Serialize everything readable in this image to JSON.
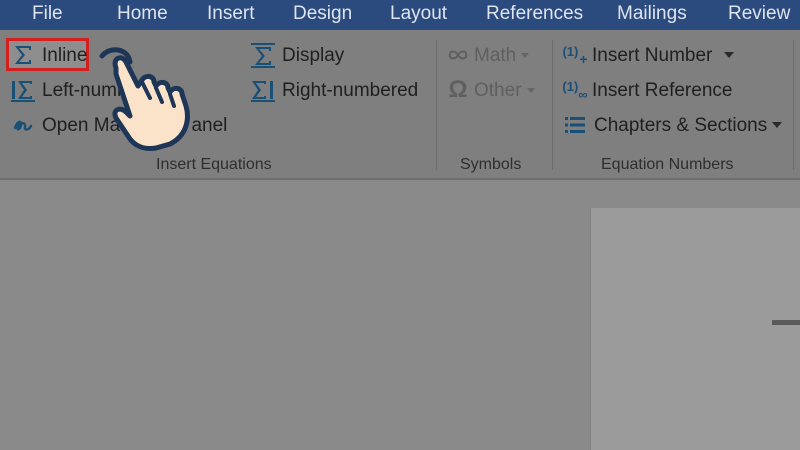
{
  "tabs": [
    "File",
    "Home",
    "Insert",
    "Design",
    "Layout",
    "References",
    "Mailings",
    "Review"
  ],
  "insert_equations": {
    "inline_label": "Inline",
    "display_label": "Display",
    "left_numbered_label": "Left-numb",
    "right_numbered_label": "Right-numbered",
    "math_panel_label_start": "Open Mat",
    "math_panel_label_end": "anel",
    "group_label": "Insert Equations"
  },
  "symbols": {
    "math_label": "Math",
    "other_label": "Other",
    "group_label": "Symbols"
  },
  "equation_numbers": {
    "insert_number_label": "Insert Number",
    "insert_reference_label": "Insert Reference",
    "chapters_label": "Chapters & Sections",
    "group_label": "Equation Numbers",
    "number_icon_text": "(1)"
  },
  "colors": {
    "tab_bar": "#2b4a7e",
    "highlight_border": "#d21f1f",
    "icon_blue": "#1a4f76",
    "hand_outline": "#1d3557",
    "hand_fill": "#fbe3c9"
  }
}
